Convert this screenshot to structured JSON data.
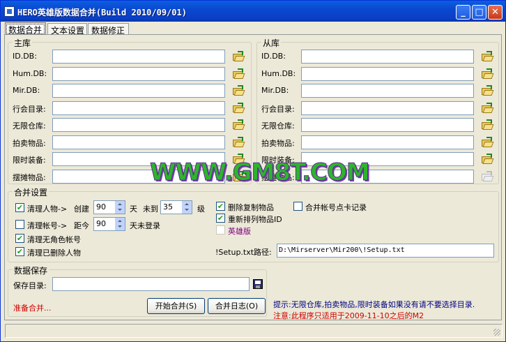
{
  "window": {
    "title": "HERO英雄版数据合并(Build 2010/09/01)"
  },
  "tabs": [
    {
      "label": "数据合并"
    },
    {
      "label": "文本设置"
    },
    {
      "label": "数据修正"
    }
  ],
  "main_db": {
    "title": "主库",
    "rows": [
      {
        "label": "ID.DB:",
        "value": ""
      },
      {
        "label": "Hum.DB:",
        "value": ""
      },
      {
        "label": "Mir.DB:",
        "value": ""
      },
      {
        "label": "行会目录:",
        "value": ""
      },
      {
        "label": "无限仓库:",
        "value": ""
      },
      {
        "label": "拍卖物品:",
        "value": ""
      },
      {
        "label": "限时装备:",
        "value": ""
      },
      {
        "label": "摆摊物品:",
        "value": ""
      }
    ]
  },
  "slave_db": {
    "title": "从库",
    "rows": [
      {
        "label": "ID.DB:",
        "value": ""
      },
      {
        "label": "Hum.DB:",
        "value": ""
      },
      {
        "label": "Mir.DB:",
        "value": ""
      },
      {
        "label": "行会目录:",
        "value": ""
      },
      {
        "label": "无限仓库:",
        "value": ""
      },
      {
        "label": "拍卖物品:",
        "value": ""
      },
      {
        "label": "限时装备:",
        "value": ""
      },
      {
        "label": "摆摊物品:",
        "value": ""
      }
    ]
  },
  "merge": {
    "title": "合并设置",
    "clean_char": {
      "label": "清理人物->",
      "created": "创建",
      "days_value": "90",
      "days_unit": "天",
      "until": "未到",
      "level_value": "35",
      "level_unit": "级",
      "checked": true
    },
    "clean_acct": {
      "label": "清理帐号->",
      "since": "距今",
      "days_value": "90",
      "suffix": "天未登录",
      "checked": false
    },
    "clean_no_char": {
      "label": "清理无角色帐号",
      "checked": true
    },
    "clean_deleted": {
      "label": "清理已删除人物",
      "checked": true
    },
    "del_dup": {
      "label": "删除复制物品",
      "checked": true
    },
    "resort_ids": {
      "label": "重新排列物品ID",
      "checked": true
    },
    "hero_ver": {
      "label": "英雄版",
      "checked": false
    },
    "merge_card": {
      "label": "合并帐号点卡记录",
      "checked": false
    },
    "setup_path": {
      "label": "!Setup.txt路径:",
      "value": "D:\\Mirserver\\Mir200\\!Setup.txt"
    }
  },
  "save": {
    "title": "数据保存",
    "dir_label": "保存目录:",
    "dir_value": "",
    "status": "准备合并...",
    "start_button": "开始合并(S)",
    "log_button": "合并日志(O)"
  },
  "notes": {
    "tip": "提示:无限仓库,拍卖物品,限时装备如果没有请不要选择目录.",
    "warn": "注意:此程序只适用于2009-11-10之后的M2"
  },
  "watermark": "WWW.GM8T.COM",
  "colors": {
    "title_bar": "#0A48D0",
    "status_red": "#CC0000",
    "tip_blue": "#000080",
    "hero_purple": "#800080"
  }
}
